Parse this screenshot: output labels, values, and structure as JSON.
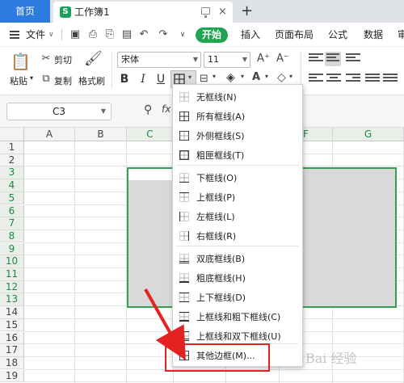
{
  "tabs": {
    "home_label": "首页",
    "doc_badge": "S",
    "doc_title": "工作簿1",
    "close": "×",
    "add": "+"
  },
  "menu": {
    "file_label": "文件",
    "start_label": "开始",
    "items": [
      "插入",
      "页面布局",
      "公式",
      "数据",
      "审"
    ]
  },
  "ribbon": {
    "paste_label": "粘贴",
    "cut_label": "剪切",
    "copy_label": "复制",
    "format_painter_label": "格式刷",
    "font_name": "宋体",
    "font_size": "11",
    "bold": "B",
    "italic": "I",
    "underline": "U",
    "grow_font": "A⁺",
    "shrink_font": "A⁻"
  },
  "formula_bar": {
    "cell_ref": "C3",
    "fx": "fx"
  },
  "grid": {
    "columns": [
      "A",
      "B",
      "C",
      "D",
      "E",
      "F",
      "G"
    ],
    "selected_columns": [
      "C",
      "D",
      "E",
      "F",
      "G"
    ],
    "rows": [
      "1",
      "2",
      "3",
      "4",
      "5",
      "6",
      "7",
      "8",
      "9",
      "10",
      "11",
      "12",
      "13",
      "14",
      "15",
      "16",
      "17",
      "18",
      "19"
    ],
    "selected_rows": [
      "3",
      "4",
      "5",
      "6",
      "7",
      "8",
      "9",
      "10",
      "11",
      "12",
      "13"
    ]
  },
  "border_menu": {
    "items": [
      {
        "label": "无框线(N)",
        "icon": "no-border-icon"
      },
      {
        "label": "所有框线(A)",
        "icon": "all-borders-icon"
      },
      {
        "label": "外侧框线(S)",
        "icon": "outside-borders-icon"
      },
      {
        "label": "粗匣框线(T)",
        "icon": "thick-box-border-icon"
      },
      {
        "label": "下框线(O)",
        "icon": "bottom-border-icon"
      },
      {
        "label": "上框线(P)",
        "icon": "top-border-icon"
      },
      {
        "label": "左框线(L)",
        "icon": "left-border-icon"
      },
      {
        "label": "右框线(R)",
        "icon": "right-border-icon"
      },
      {
        "label": "双底框线(B)",
        "icon": "double-bottom-border-icon"
      },
      {
        "label": "粗底框线(H)",
        "icon": "thick-bottom-border-icon"
      },
      {
        "label": "上下框线(D)",
        "icon": "top-bottom-border-icon"
      },
      {
        "label": "上框线和粗下框线(C)",
        "icon": "top-thick-bottom-border-icon"
      },
      {
        "label": "上框线和双下框线(U)",
        "icon": "top-double-bottom-border-icon"
      },
      {
        "label": "其他边框(M)...",
        "icon": "more-borders-icon"
      }
    ]
  },
  "watermark": "Bai 经验",
  "colors": {
    "accent_blue": "#2c7be0",
    "start_green": "#20a44f",
    "selection_green": "#35a04e",
    "annotation_red": "#e52222"
  }
}
